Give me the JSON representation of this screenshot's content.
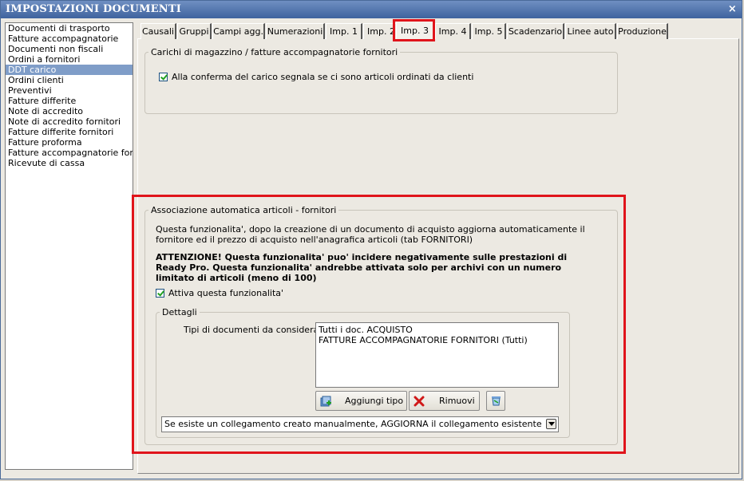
{
  "window": {
    "title": "IMPOSTAZIONI DOCUMENTI",
    "close_glyph": "×"
  },
  "sidebar": {
    "items": [
      {
        "label": "Documenti di trasporto"
      },
      {
        "label": "Fatture accompagnatorie"
      },
      {
        "label": "Documenti non fiscali"
      },
      {
        "label": "Ordini a fornitori"
      },
      {
        "label": "DDT carico",
        "selected": true
      },
      {
        "label": "Ordini clienti"
      },
      {
        "label": "Preventivi"
      },
      {
        "label": "Fatture differite"
      },
      {
        "label": "Note di accredito"
      },
      {
        "label": "Note di accredito fornitori"
      },
      {
        "label": "Fatture differite fornitori"
      },
      {
        "label": "Fatture proforma"
      },
      {
        "label": "Fatture accompagnatorie fornitori"
      },
      {
        "label": "Ricevute di cassa"
      }
    ]
  },
  "tabs": [
    {
      "label": "Causali"
    },
    {
      "label": "Gruppi"
    },
    {
      "label": "Campi agg."
    },
    {
      "label": "Numerazioni"
    },
    {
      "label": "Imp. 1"
    },
    {
      "label": "Imp. 2"
    },
    {
      "label": "Imp. 3",
      "active": true
    },
    {
      "label": "Imp. 4"
    },
    {
      "label": "Imp. 5"
    },
    {
      "label": "Scadenzario"
    },
    {
      "label": "Linee auto"
    },
    {
      "label": "Produzione"
    }
  ],
  "carichi": {
    "legend": "Carichi di magazzino / fatture accompagnatorie fornitori",
    "checkbox_label": "Alla conferma del carico segnala se ci sono articoli ordinati da clienti",
    "checked": true
  },
  "associazione": {
    "legend": "Associazione automatica articoli - fornitori",
    "desc_line1": "Questa funzionalita', dopo la creazione di un documento di acquisto aggiorna automaticamente il",
    "desc_line2": "fornitore ed il prezzo di acquisto nell'anagrafica articoli (tab FORNITORI)",
    "warn_line1": "ATTENZIONE! Questa funzionalita' puo' incidere negativamente sulle prestazioni di",
    "warn_line2": "Ready Pro. Questa funzionalita' andrebbe attivata solo per archivi con un numero",
    "warn_line3": "limitato di articoli (meno di 100)",
    "enable_label": "Attiva questa funzionalita'",
    "enabled": true,
    "dettagli": {
      "legend": "Dettagli",
      "tipi_label": "Tipi di documenti da considerare:",
      "tipi": [
        "Tutti i doc. ACQUISTO",
        "FATTURE ACCOMPAGNATORIE FORNITORI (Tutti)"
      ],
      "add_label": "Aggiungi tipo",
      "remove_label": "Rimuovi",
      "combo_value": "Se esiste un collegamento creato manualmente, AGGIORNA il collegamento esistente"
    }
  },
  "colors": {
    "highlight": "#e0141b",
    "selection": "#7f9dc8",
    "title_bar": "#4f73aa"
  }
}
